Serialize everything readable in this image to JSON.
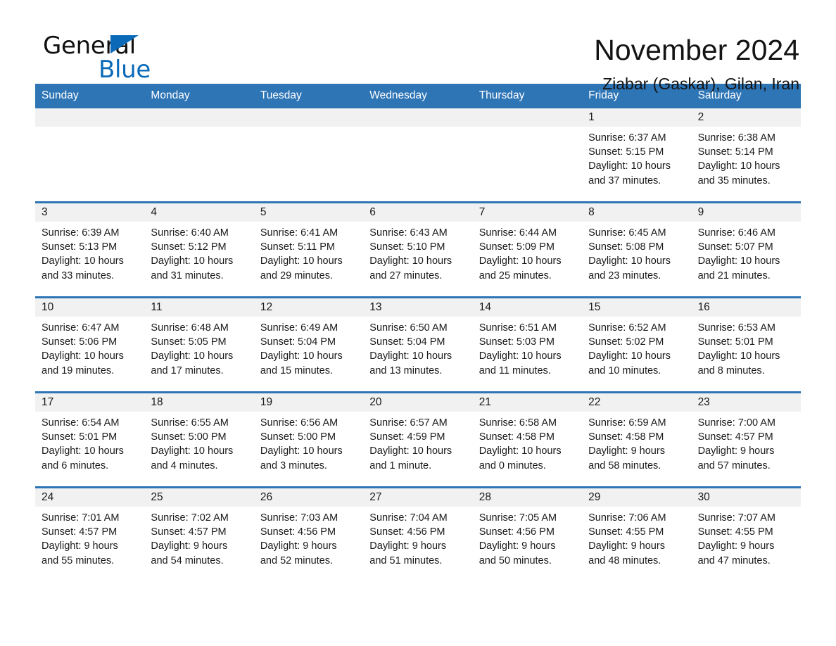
{
  "brand": {
    "name_part1": "General",
    "name_part2": "Blue",
    "triangle_color": "#0b6ab8"
  },
  "header": {
    "title": "November 2024",
    "subtitle": "Ziabar (Gaskar), Gilan, Iran",
    "accent_color": "#2e75b6",
    "daynum_band_color": "#f1f1f1"
  },
  "weekday_headers": [
    "Sunday",
    "Monday",
    "Tuesday",
    "Wednesday",
    "Thursday",
    "Friday",
    "Saturday"
  ],
  "labels": {
    "sunrise_prefix": "Sunrise:",
    "sunset_prefix": "Sunset:",
    "daylight_prefix": "Daylight:"
  },
  "weeks": [
    [
      {
        "day": "",
        "empty": true,
        "line1": "",
        "line2": "",
        "line3": "",
        "line4": ""
      },
      {
        "day": "",
        "empty": true,
        "line1": "",
        "line2": "",
        "line3": "",
        "line4": ""
      },
      {
        "day": "",
        "empty": true,
        "line1": "",
        "line2": "",
        "line3": "",
        "line4": ""
      },
      {
        "day": "",
        "empty": true,
        "line1": "",
        "line2": "",
        "line3": "",
        "line4": ""
      },
      {
        "day": "",
        "empty": true,
        "line1": "",
        "line2": "",
        "line3": "",
        "line4": ""
      },
      {
        "day": "1",
        "empty": false,
        "line1": "Sunrise: 6:37 AM",
        "line2": "Sunset: 5:15 PM",
        "line3": "Daylight: 10 hours",
        "line4": "and 37 minutes."
      },
      {
        "day": "2",
        "empty": false,
        "line1": "Sunrise: 6:38 AM",
        "line2": "Sunset: 5:14 PM",
        "line3": "Daylight: 10 hours",
        "line4": "and 35 minutes."
      }
    ],
    [
      {
        "day": "3",
        "empty": false,
        "line1": "Sunrise: 6:39 AM",
        "line2": "Sunset: 5:13 PM",
        "line3": "Daylight: 10 hours",
        "line4": "and 33 minutes."
      },
      {
        "day": "4",
        "empty": false,
        "line1": "Sunrise: 6:40 AM",
        "line2": "Sunset: 5:12 PM",
        "line3": "Daylight: 10 hours",
        "line4": "and 31 minutes."
      },
      {
        "day": "5",
        "empty": false,
        "line1": "Sunrise: 6:41 AM",
        "line2": "Sunset: 5:11 PM",
        "line3": "Daylight: 10 hours",
        "line4": "and 29 minutes."
      },
      {
        "day": "6",
        "empty": false,
        "line1": "Sunrise: 6:43 AM",
        "line2": "Sunset: 5:10 PM",
        "line3": "Daylight: 10 hours",
        "line4": "and 27 minutes."
      },
      {
        "day": "7",
        "empty": false,
        "line1": "Sunrise: 6:44 AM",
        "line2": "Sunset: 5:09 PM",
        "line3": "Daylight: 10 hours",
        "line4": "and 25 minutes."
      },
      {
        "day": "8",
        "empty": false,
        "line1": "Sunrise: 6:45 AM",
        "line2": "Sunset: 5:08 PM",
        "line3": "Daylight: 10 hours",
        "line4": "and 23 minutes."
      },
      {
        "day": "9",
        "empty": false,
        "line1": "Sunrise: 6:46 AM",
        "line2": "Sunset: 5:07 PM",
        "line3": "Daylight: 10 hours",
        "line4": "and 21 minutes."
      }
    ],
    [
      {
        "day": "10",
        "empty": false,
        "line1": "Sunrise: 6:47 AM",
        "line2": "Sunset: 5:06 PM",
        "line3": "Daylight: 10 hours",
        "line4": "and 19 minutes."
      },
      {
        "day": "11",
        "empty": false,
        "line1": "Sunrise: 6:48 AM",
        "line2": "Sunset: 5:05 PM",
        "line3": "Daylight: 10 hours",
        "line4": "and 17 minutes."
      },
      {
        "day": "12",
        "empty": false,
        "line1": "Sunrise: 6:49 AM",
        "line2": "Sunset: 5:04 PM",
        "line3": "Daylight: 10 hours",
        "line4": "and 15 minutes."
      },
      {
        "day": "13",
        "empty": false,
        "line1": "Sunrise: 6:50 AM",
        "line2": "Sunset: 5:04 PM",
        "line3": "Daylight: 10 hours",
        "line4": "and 13 minutes."
      },
      {
        "day": "14",
        "empty": false,
        "line1": "Sunrise: 6:51 AM",
        "line2": "Sunset: 5:03 PM",
        "line3": "Daylight: 10 hours",
        "line4": "and 11 minutes."
      },
      {
        "day": "15",
        "empty": false,
        "line1": "Sunrise: 6:52 AM",
        "line2": "Sunset: 5:02 PM",
        "line3": "Daylight: 10 hours",
        "line4": "and 10 minutes."
      },
      {
        "day": "16",
        "empty": false,
        "line1": "Sunrise: 6:53 AM",
        "line2": "Sunset: 5:01 PM",
        "line3": "Daylight: 10 hours",
        "line4": "and 8 minutes."
      }
    ],
    [
      {
        "day": "17",
        "empty": false,
        "line1": "Sunrise: 6:54 AM",
        "line2": "Sunset: 5:01 PM",
        "line3": "Daylight: 10 hours",
        "line4": "and 6 minutes."
      },
      {
        "day": "18",
        "empty": false,
        "line1": "Sunrise: 6:55 AM",
        "line2": "Sunset: 5:00 PM",
        "line3": "Daylight: 10 hours",
        "line4": "and 4 minutes."
      },
      {
        "day": "19",
        "empty": false,
        "line1": "Sunrise: 6:56 AM",
        "line2": "Sunset: 5:00 PM",
        "line3": "Daylight: 10 hours",
        "line4": "and 3 minutes."
      },
      {
        "day": "20",
        "empty": false,
        "line1": "Sunrise: 6:57 AM",
        "line2": "Sunset: 4:59 PM",
        "line3": "Daylight: 10 hours",
        "line4": "and 1 minute."
      },
      {
        "day": "21",
        "empty": false,
        "line1": "Sunrise: 6:58 AM",
        "line2": "Sunset: 4:58 PM",
        "line3": "Daylight: 10 hours",
        "line4": "and 0 minutes."
      },
      {
        "day": "22",
        "empty": false,
        "line1": "Sunrise: 6:59 AM",
        "line2": "Sunset: 4:58 PM",
        "line3": "Daylight: 9 hours",
        "line4": "and 58 minutes."
      },
      {
        "day": "23",
        "empty": false,
        "line1": "Sunrise: 7:00 AM",
        "line2": "Sunset: 4:57 PM",
        "line3": "Daylight: 9 hours",
        "line4": "and 57 minutes."
      }
    ],
    [
      {
        "day": "24",
        "empty": false,
        "line1": "Sunrise: 7:01 AM",
        "line2": "Sunset: 4:57 PM",
        "line3": "Daylight: 9 hours",
        "line4": "and 55 minutes."
      },
      {
        "day": "25",
        "empty": false,
        "line1": "Sunrise: 7:02 AM",
        "line2": "Sunset: 4:57 PM",
        "line3": "Daylight: 9 hours",
        "line4": "and 54 minutes."
      },
      {
        "day": "26",
        "empty": false,
        "line1": "Sunrise: 7:03 AM",
        "line2": "Sunset: 4:56 PM",
        "line3": "Daylight: 9 hours",
        "line4": "and 52 minutes."
      },
      {
        "day": "27",
        "empty": false,
        "line1": "Sunrise: 7:04 AM",
        "line2": "Sunset: 4:56 PM",
        "line3": "Daylight: 9 hours",
        "line4": "and 51 minutes."
      },
      {
        "day": "28",
        "empty": false,
        "line1": "Sunrise: 7:05 AM",
        "line2": "Sunset: 4:56 PM",
        "line3": "Daylight: 9 hours",
        "line4": "and 50 minutes."
      },
      {
        "day": "29",
        "empty": false,
        "line1": "Sunrise: 7:06 AM",
        "line2": "Sunset: 4:55 PM",
        "line3": "Daylight: 9 hours",
        "line4": "and 48 minutes."
      },
      {
        "day": "30",
        "empty": false,
        "line1": "Sunrise: 7:07 AM",
        "line2": "Sunset: 4:55 PM",
        "line3": "Daylight: 9 hours",
        "line4": "and 47 minutes."
      }
    ]
  ]
}
